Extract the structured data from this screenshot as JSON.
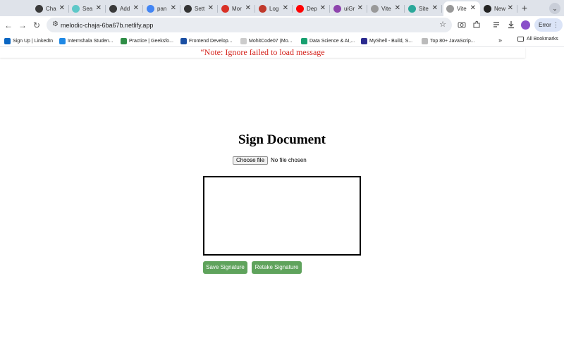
{
  "tabs": [
    {
      "label": "Cha",
      "icon": "openai-icon",
      "color": "#3a3a3a"
    },
    {
      "label": "Sea",
      "icon": "triangle-icon",
      "color": "#5ec8c8"
    },
    {
      "label": "Add",
      "icon": "openai-icon",
      "color": "#3a3a3a"
    },
    {
      "label": "pan",
      "icon": "google-icon",
      "color": "#4285f4"
    },
    {
      "label": "Sett",
      "icon": "gear-icon",
      "color": "#333333"
    },
    {
      "label": "Mor",
      "icon": "gmail-icon",
      "color": "#d93025"
    },
    {
      "label": "Log",
      "icon": "circle-icon",
      "color": "#c0392b"
    },
    {
      "label": "Dep",
      "icon": "youtube-icon",
      "color": "#ff0000"
    },
    {
      "label": "uiGr",
      "icon": "square-icon",
      "color": "#8e44ad"
    },
    {
      "label": "Vite",
      "icon": "globe-icon",
      "color": "#999999"
    },
    {
      "label": "Site",
      "icon": "diamond-icon",
      "color": "#2ba89a"
    },
    {
      "label": "Vite",
      "icon": "globe-icon",
      "color": "#999999",
      "active": true
    },
    {
      "label": "New",
      "icon": "github-icon",
      "color": "#222222"
    }
  ],
  "tab_close_glyph": "✕",
  "new_tab_glyph": "+",
  "tab_search_glyph": "⌄",
  "toolbar": {
    "back_glyph": "←",
    "forward_glyph": "→",
    "reload_glyph": "↻",
    "site_info_glyph": "⚙",
    "url": "melodic-chaja-6ba67b.netlify.app",
    "star_glyph": "☆",
    "error_label": "Error",
    "menu_glyph": "⋮"
  },
  "bookmarks": [
    {
      "label": "Sign Up | LinkedIn",
      "color": "#0a66c2"
    },
    {
      "label": "Internshala Studen...",
      "color": "#1e88e5"
    },
    {
      "label": "Practice | Geeksfo...",
      "color": "#2f8d46"
    },
    {
      "label": "Frontend Develop...",
      "color": "#1a4fa3"
    },
    {
      "label": "MohitCode07 (Mo...",
      "color": "#cccccc"
    },
    {
      "label": "Data Science & AI,...",
      "color": "#18a070"
    },
    {
      "label": "MyShell - Build, S...",
      "color": "#2b2b8f"
    },
    {
      "label": "Top 80+ JavaScrip...",
      "color": "#bbbbbb"
    }
  ],
  "bookmarks_more": "»",
  "all_bookmarks": "All Bookmarks",
  "page": {
    "note": "“Note: Ignore failed to load message",
    "title": "Sign Document",
    "choose_file_label": "Choose file",
    "file_status": "No file chosen",
    "save_label": "Save Signature",
    "retake_label": "Retake Signature"
  },
  "colors": {
    "note_red": "#d4221b",
    "button_green": "#5fa35c"
  }
}
